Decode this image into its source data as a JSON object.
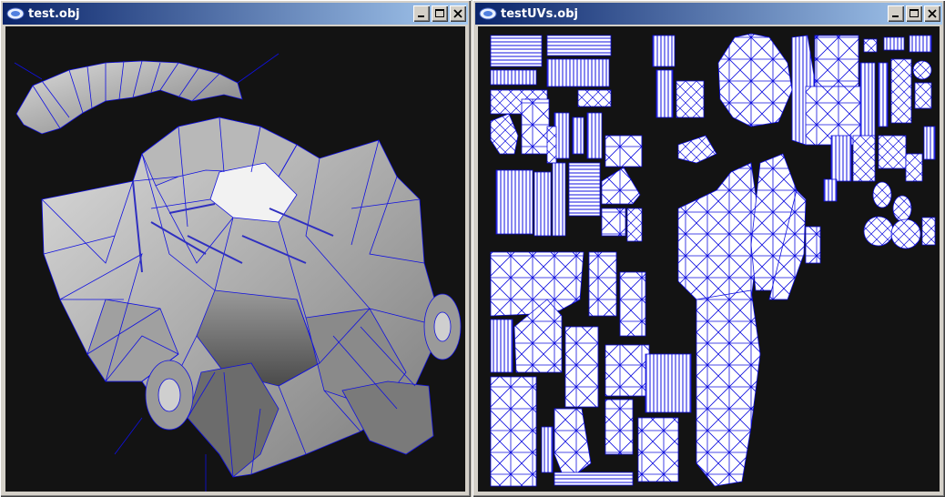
{
  "windows": [
    {
      "title": "test.obj",
      "icon": "app-icon",
      "buttons": [
        "minimize-icon",
        "maximize-icon",
        "close-icon"
      ],
      "viewport": {
        "background": "#131313",
        "content": "3d-wireframe-model"
      }
    },
    {
      "title": "testUVs.obj",
      "icon": "app-icon",
      "buttons": [
        "minimize-icon",
        "maximize-icon",
        "close-icon"
      ],
      "viewport": {
        "background": "#131313",
        "content": "uv-layout"
      }
    }
  ],
  "colors": {
    "titlebar_start": "#0a246a",
    "titlebar_end": "#a6caf0",
    "wire": "#1010e0",
    "face_light": "#e8e8e8",
    "face_mid": "#a8a8a8",
    "face_dark": "#6a6a6a"
  }
}
